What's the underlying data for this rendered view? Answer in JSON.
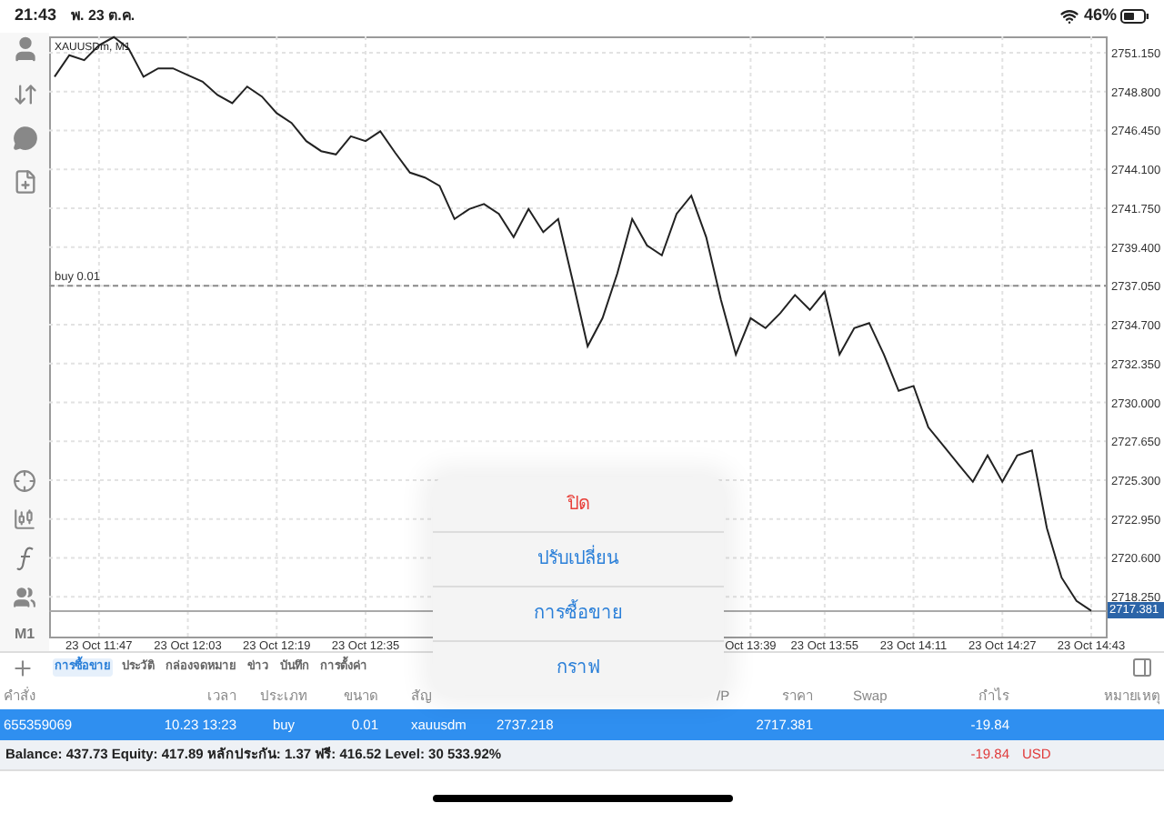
{
  "status_bar": {
    "time": "21:43",
    "date": "พ. 23 ต.ค.",
    "battery": "46%"
  },
  "toolbar": {
    "timeframe": "M1"
  },
  "chart": {
    "chart_data": {
      "type": "line",
      "title": "XAUUSDm, M1",
      "grid": true,
      "categories": [
        null,
        null,
        null,
        "23 Oct 11:47",
        null,
        null,
        null,
        null,
        null,
        "23 Oct 12:03",
        null,
        null,
        null,
        null,
        null,
        "23 Oct 12:19",
        null,
        null,
        null,
        null,
        null,
        "23 Oct 12:35",
        null,
        null,
        null,
        null,
        null,
        null,
        null,
        null,
        null,
        null,
        null,
        null,
        null,
        null,
        null,
        null,
        null,
        null,
        null,
        null,
        null,
        null,
        null,
        null,
        null,
        "Oct 13:39",
        null,
        null,
        null,
        null,
        "23 Oct 13:55",
        null,
        null,
        null,
        null,
        null,
        "23 Oct 14:11",
        null,
        null,
        null,
        null,
        null,
        "23 Oct 14:27",
        null,
        null,
        null,
        null,
        null,
        "23 Oct 14:43"
      ],
      "series": [
        {
          "color": "#222222",
          "values": [
            2749.7,
            2751.0,
            2750.7,
            2751.6,
            2752.1,
            2751.4,
            2749.7,
            2750.2,
            2750.2,
            2749.8,
            2749.4,
            2748.6,
            2748.1,
            2749.1,
            2748.5,
            2747.5,
            2746.9,
            2745.8,
            2745.2,
            2745.0,
            2746.1,
            2745.8,
            2746.4,
            2745.1,
            2743.9,
            2743.6,
            2743.1,
            2741.1,
            2741.7,
            2742.0,
            2741.4,
            2740.0,
            2741.7,
            2740.3,
            2741.1,
            2737.3,
            2733.4,
            2735.1,
            2737.8,
            2741.1,
            2739.5,
            2738.9,
            2741.4,
            2742.5,
            2740.0,
            2736.2,
            2732.9,
            2735.1,
            2734.5,
            2735.4,
            2736.5,
            2735.6,
            2736.7,
            2732.9,
            2734.5,
            2734.8,
            2732.9,
            2730.7,
            2731.0,
            2728.5,
            2727.4,
            2726.3,
            2725.2,
            2726.8,
            2725.2,
            2726.8,
            2727.1,
            2722.4,
            2719.4,
            2718.0,
            2717.4
          ]
        }
      ],
      "ylim": [
        2715.84,
        2752.14
      ],
      "yticks": [
        {
          "value": 2751.15,
          "label": "2751.150"
        },
        {
          "value": 2748.8,
          "label": "2748.800"
        },
        {
          "value": 2746.45,
          "label": "2746.450"
        },
        {
          "value": 2744.1,
          "label": "2744.100"
        },
        {
          "value": 2741.75,
          "label": "2741.750"
        },
        {
          "value": 2739.4,
          "label": "2739.400"
        },
        {
          "value": 2737.05,
          "label": "2737.050"
        },
        {
          "value": 2734.7,
          "label": "2734.700"
        },
        {
          "value": 2732.35,
          "label": "2732.350"
        },
        {
          "value": 2730.0,
          "label": "2730.000"
        },
        {
          "value": 2727.65,
          "label": "2727.650"
        },
        {
          "value": 2725.3,
          "label": "2725.300"
        },
        {
          "value": 2722.95,
          "label": "2722.950"
        },
        {
          "value": 2720.6,
          "label": "2720.600"
        },
        {
          "value": 2718.25,
          "label": "2718.250"
        }
      ],
      "ref_lines": [
        {
          "axis": "y",
          "value": 2737.05,
          "label": "buy 0.01"
        },
        {
          "axis": "y",
          "value": 2717.381,
          "label": "2717.381"
        }
      ]
    }
  },
  "tabs": [
    {
      "label": "การซื้อขาย",
      "selected": true
    },
    {
      "label": "ประวัติ",
      "selected": false
    },
    {
      "label": "กล่องจดหมาย",
      "selected": false
    },
    {
      "label": "ข่าว",
      "selected": false
    },
    {
      "label": "บันทึก",
      "selected": false
    },
    {
      "label": "การตั้งค่า",
      "selected": false
    }
  ],
  "table": {
    "columns": [
      "คำสั่ง",
      "เวลา",
      "ประเภท",
      "ขนาด",
      "สัญ",
      "/P",
      "ราคา",
      "Swap",
      "กำไร",
      "หมายเหตุ"
    ],
    "rows": [
      {
        "order": "655359069",
        "time": "10.23 13:23",
        "type": "buy",
        "volume": "0.01",
        "symbol": "xauusdm",
        "open_price": "2737.218",
        "price": "2717.381",
        "profit": "-19.84",
        "selected": true
      }
    ]
  },
  "summary": {
    "text": "Balance: 437.73 Equity: 417.89 หลักประกัน: 1.37 ฟรี: 416.52 Level: 30 533.92%",
    "profit": "-19.84",
    "currency": "USD"
  },
  "action_menu": {
    "items": [
      {
        "label": "ปิด",
        "kind": "destructive"
      },
      {
        "label": "ปรับเปลี่ยน",
        "kind": "default"
      },
      {
        "label": "การซื้อขาย",
        "kind": "default"
      },
      {
        "label": "กราฟ",
        "kind": "default"
      }
    ]
  }
}
